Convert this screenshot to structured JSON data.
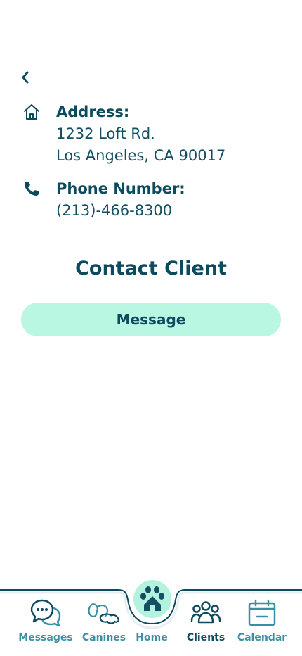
{
  "address": {
    "label": "Address:",
    "line1": "1232 Loft Rd.",
    "line2": "Los Angeles, CA 90017"
  },
  "phone": {
    "label": "Phone Number:",
    "value": "(213)-466-8300"
  },
  "contact": {
    "title": "Contact Client",
    "message_button": "Message"
  },
  "nav": {
    "messages": "Messages",
    "canines": "Canines",
    "home": "Home",
    "clients": "Clients",
    "calendar": "Calendar",
    "active": "clients"
  },
  "colors": {
    "primary": "#0d4a5e",
    "accent": "#b9f7e3",
    "nav_inactive": "#3a8fa3"
  }
}
